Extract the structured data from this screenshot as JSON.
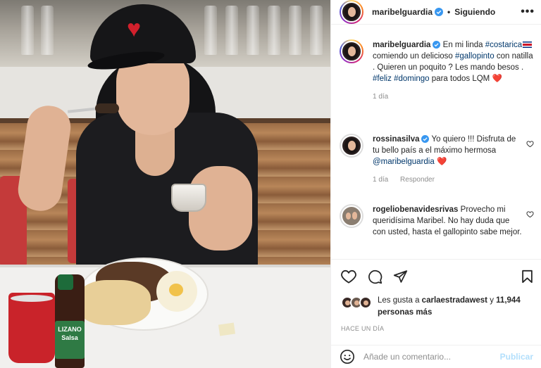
{
  "photo": {
    "bottle_label": "LIZANO Salsa"
  },
  "header": {
    "username": "maribelguardia",
    "separator": "•",
    "follow_status": "Siguiendo",
    "more_icon": "more-horizontal-icon",
    "more_glyph": "•••"
  },
  "caption": {
    "username": "maribelguardia",
    "text_1": "En mi linda",
    "hashtag_costarica": "#costarica",
    "text_2": "comiendo un delicioso",
    "hashtag_gallopinto": "#gallopinto",
    "text_3": "con natilla . Quieren un poquito ? Les mando besos .",
    "hashtag_feliz": "#feliz",
    "hashtag_domingo": "#domingo",
    "text_4": "para todos LQM",
    "heart_emoji": "❤️",
    "time": "1 día"
  },
  "comments": [
    {
      "username": "rossinasilva",
      "text_1": "Yo quiero !!! Disfruta de tu bello país a el máximo hermosa",
      "mention": "@maribelguardia",
      "heart_emoji": "❤️",
      "time": "1 día",
      "reply_label": "Responder"
    },
    {
      "username": "rogeliobenavidesrivas",
      "text": "Provecho mi queridísima Maribel. No hay duda que con usted, hasta el gallopinto sabe mejor."
    }
  ],
  "actions": {
    "like_icon": "heart-icon",
    "comment_icon": "comment-icon",
    "share_icon": "send-icon",
    "save_icon": "bookmark-icon"
  },
  "likes": {
    "prefix": "Les gusta a",
    "first_user": "carlaestradawest",
    "connector": "y",
    "count_text": "11,944 personas más"
  },
  "timestamp": "HACE UN DÍA",
  "add_comment": {
    "emoji_icon": "smiley-icon",
    "placeholder": "Añade un comentario...",
    "publish_label": "Publicar"
  },
  "colors": {
    "link": "#00376b",
    "secondary": "#8e8e8e",
    "verified": "#3897f0",
    "publish_disabled": "#b2dffc",
    "heart": "#ed4956"
  }
}
